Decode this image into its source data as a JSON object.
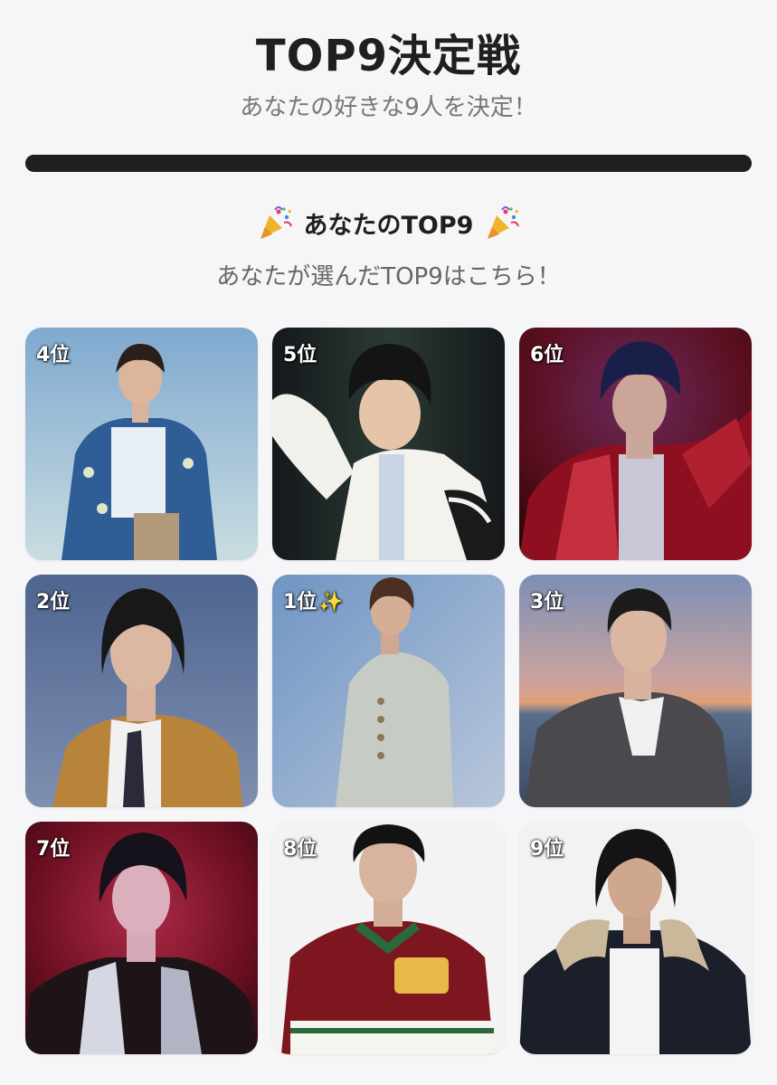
{
  "header": {
    "title": "TOP9決定戦",
    "subtitle": "あなたの好きな9人を決定！"
  },
  "progress": {
    "value": 1.0
  },
  "result": {
    "heading": "あなたのTOP9",
    "subheading": "あなたが選んだTOP9はこちら！",
    "heading_icon": "party-popper-icon"
  },
  "cards": [
    {
      "rank": "4位",
      "bg": "#8fb6d6"
    },
    {
      "rank": "5位",
      "bg": "#222428"
    },
    {
      "rank": "6位",
      "bg": "#6a1020"
    },
    {
      "rank": "2位",
      "bg": "#5a6f94"
    },
    {
      "rank": "1位",
      "sparkle": "✨",
      "bg": "#8aa6c8"
    },
    {
      "rank": "3位",
      "bg": "#9aa0b8"
    },
    {
      "rank": "7位",
      "bg": "#7a1428"
    },
    {
      "rank": "8位",
      "bg": "#f2f2f2"
    },
    {
      "rank": "9位",
      "bg": "#f2f2f2"
    }
  ]
}
